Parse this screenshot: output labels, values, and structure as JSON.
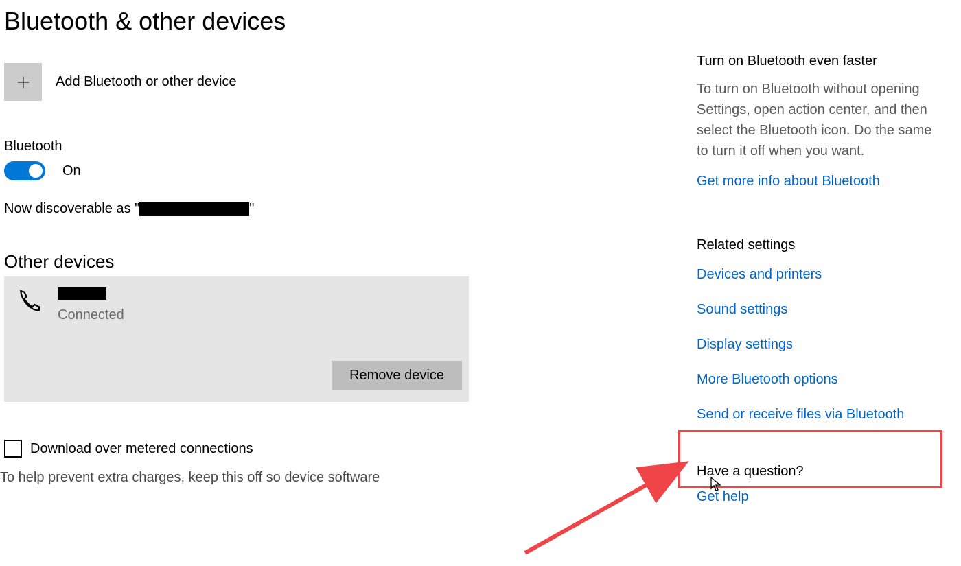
{
  "title": "Bluetooth & other devices",
  "add": {
    "label": "Add Bluetooth or other device"
  },
  "bluetooth": {
    "label": "Bluetooth",
    "state": "On",
    "discoverable_prefix": "Now discoverable as \"",
    "discoverable_suffix": "\""
  },
  "other_devices": {
    "heading": "Other devices",
    "device_status": "Connected",
    "remove_label": "Remove device"
  },
  "metered": {
    "label": "Download over metered connections",
    "help": "To help prevent extra charges, keep this off so device software"
  },
  "sidebar": {
    "tip_heading": "Turn on Bluetooth even faster",
    "tip_body": "To turn on Bluetooth without opening Settings, open action center, and then select the Bluetooth icon. Do the same to turn it off when you want.",
    "tip_link": "Get more info about Bluetooth",
    "related_heading": "Related settings",
    "links": [
      "Devices and printers",
      "Sound settings",
      "Display settings",
      "More Bluetooth options",
      "Send or receive files via Bluetooth"
    ],
    "help_heading": "Have a question?",
    "help_link": "Get help"
  },
  "colors": {
    "accent": "#0078d7",
    "link": "#0066cc",
    "highlight": "#ef4548"
  }
}
